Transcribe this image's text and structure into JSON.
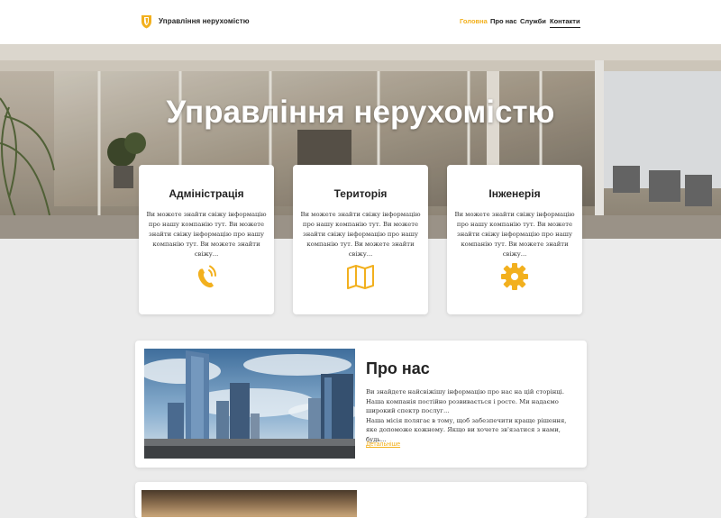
{
  "header": {
    "brand": "Управління нерухомістю",
    "nav": [
      {
        "label": "Головна"
      },
      {
        "label": "Про нас"
      },
      {
        "label": "Служби"
      },
      {
        "label": "Контакти"
      }
    ]
  },
  "hero": {
    "title": "Управління нерухомістю"
  },
  "features": [
    {
      "title": "Адміністрація",
      "text": "Ви можете знайти свіжу інформацію про нашу компанію тут. Ви можете знайти свіжу інформацію про нашу компанію тут. Ви можете знайти свіжу...",
      "icon": "phone-icon"
    },
    {
      "title": "Територія",
      "text": "Ви можете знайти свіжу інформацію про нашу компанію тут. Ви можете знайти свіжу інформацію про нашу компанію тут. Ви можете знайти свіжу...",
      "icon": "map-icon"
    },
    {
      "title": "Інженерія",
      "text": "Ви можете знайти свіжу інформацію про нашу компанію тут. Ви можете знайти свіжу інформацію про нашу компанію тут. Ви можете знайти свіжу...",
      "icon": "gear-icon"
    }
  ],
  "about": {
    "title": "Про нас",
    "paragraph1": "Ви знайдете найсвіжішу інформацію про нас на цій сторінці. Наша компанія постійно розвивається і росте. Ми надаємо широкий спектр послуг...",
    "paragraph2": "Наша місія полягає в тому, щоб забезпечити краще рішення, яке допоможе кожному. Якщо ви хочете зв'язатися з нами, будь...",
    "link": "Детальніше"
  },
  "colors": {
    "accent": "#f2b01e",
    "background": "#ebebeb"
  }
}
